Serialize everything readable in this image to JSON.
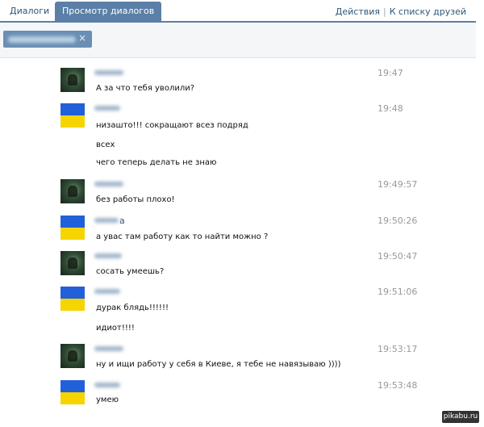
{
  "tabs": {
    "dialogs": "Диалоги",
    "view": "Просмотр диалогов"
  },
  "actions": {
    "actions_label": "Действия",
    "separator": "|",
    "friends_label": "К списку друзей"
  },
  "search": {
    "close": "×"
  },
  "messages": [
    {
      "avatar": "photo-avatar",
      "name_suffix": "",
      "time": "19:47",
      "lines": [
        "А за что тебя уволили?"
      ]
    },
    {
      "avatar": "ukraine-flag-avatar",
      "name_suffix": "",
      "time": "19:48",
      "lines": [
        "низашто!!! сокращают всез подряд",
        "всех",
        "чего теперь делать не знаю"
      ]
    },
    {
      "avatar": "photo-avatar",
      "name_suffix": "",
      "time": "19:49:57",
      "lines": [
        "без работы плохо!"
      ]
    },
    {
      "avatar": "ukraine-flag-avatar",
      "name_suffix": "а",
      "time": "19:50:26",
      "lines": [
        "а увас там работу как то найти можно ?"
      ]
    },
    {
      "avatar": "photo-avatar",
      "name_suffix": "",
      "time": "19:50:47",
      "lines": [
        "сосать умеешь?"
      ]
    },
    {
      "avatar": "ukraine-flag-avatar",
      "name_suffix": "",
      "time": "19:51:06",
      "lines": [
        "дурак блядь!!!!!!",
        "идиот!!!!"
      ]
    },
    {
      "avatar": "photo-avatar",
      "name_suffix": "",
      "time": "19:53:17",
      "lines": [
        "ну и ищи работу у себя в Киеве, я тебе не навязываю ))))"
      ]
    },
    {
      "avatar": "ukraine-flag-avatar",
      "name_suffix": "",
      "time": "19:53:48",
      "lines": [
        "умею"
      ]
    }
  ],
  "watermark": "pikabu.ru"
}
